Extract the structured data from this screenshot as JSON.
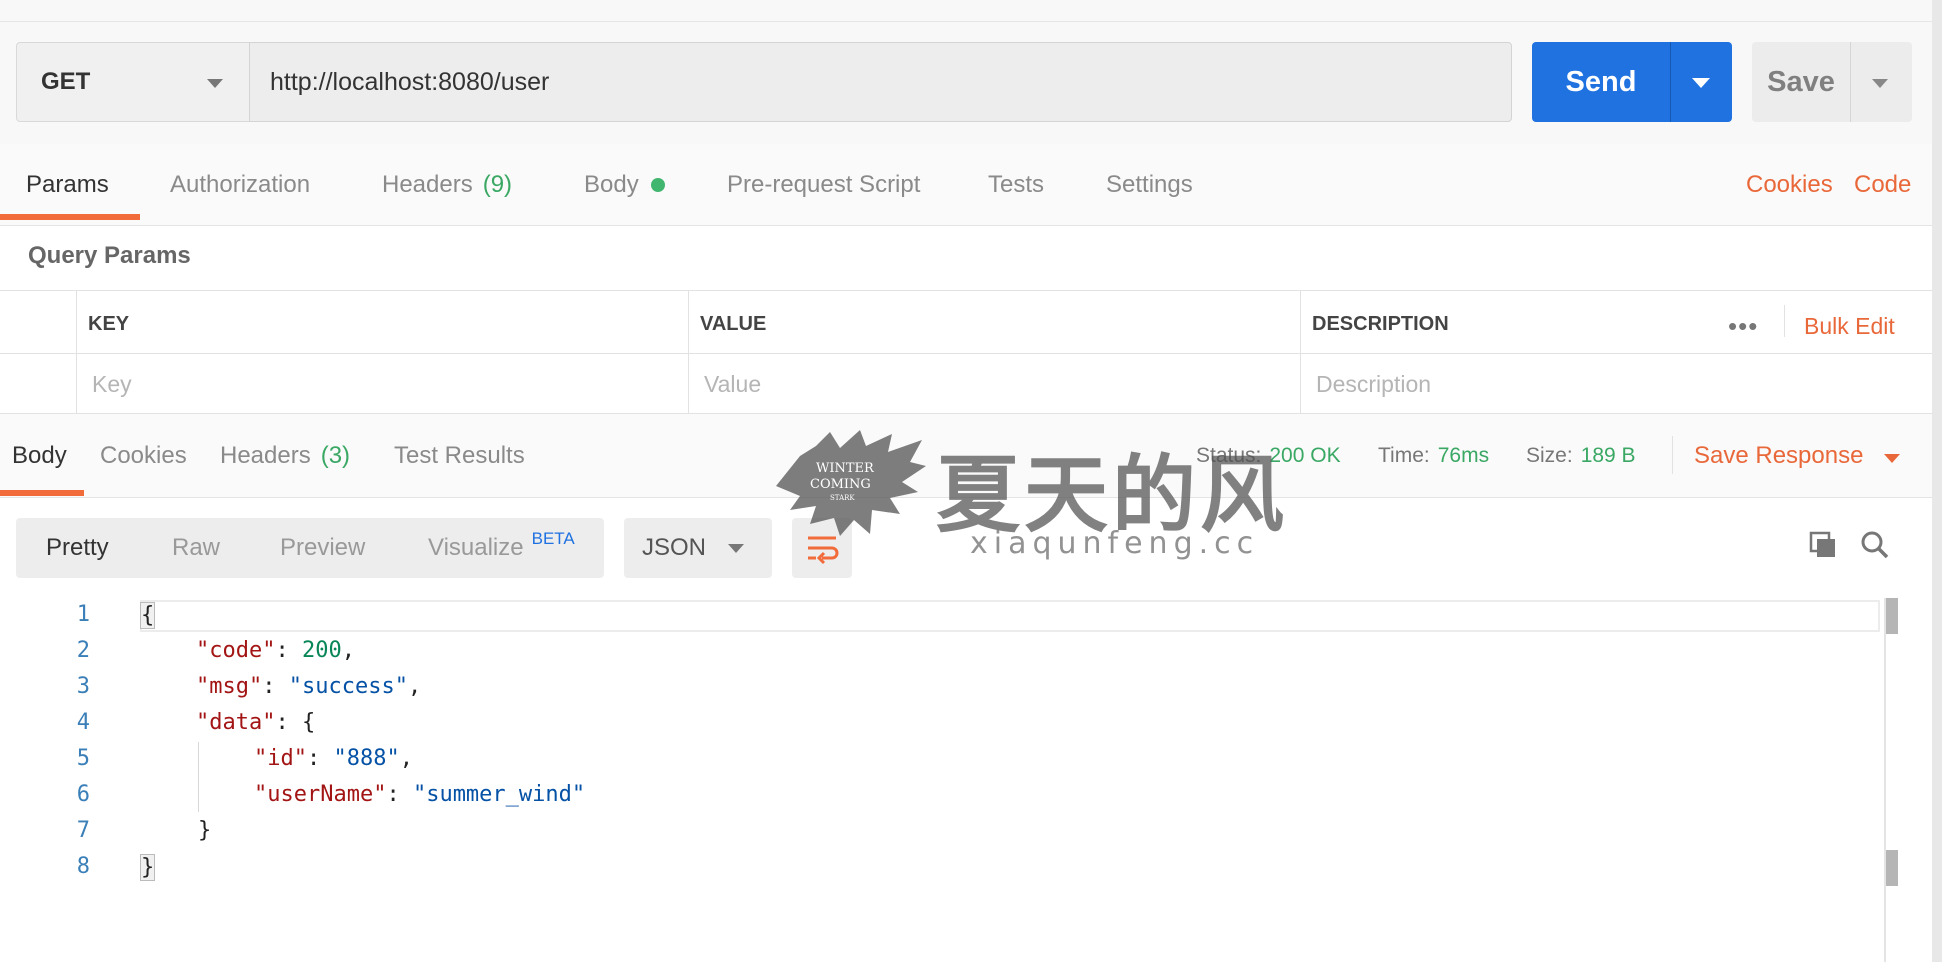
{
  "request": {
    "method": "GET",
    "url": "http://localhost:8080/user",
    "send_label": "Send",
    "save_label": "Save"
  },
  "request_tabs": [
    {
      "label": "Params"
    },
    {
      "label": "Authorization"
    },
    {
      "label": "Headers",
      "count": "(9)"
    },
    {
      "label": "Body"
    },
    {
      "label": "Pre-request Script"
    },
    {
      "label": "Tests"
    },
    {
      "label": "Settings"
    }
  ],
  "request_links": {
    "cookies": "Cookies",
    "code": "Code"
  },
  "query_params": {
    "title": "Query Params",
    "columns": [
      "KEY",
      "VALUE",
      "DESCRIPTION"
    ],
    "placeholders": [
      "Key",
      "Value",
      "Description"
    ],
    "more": "•••",
    "bulk_edit": "Bulk Edit"
  },
  "response_tabs": [
    {
      "label": "Body"
    },
    {
      "label": "Cookies"
    },
    {
      "label": "Headers",
      "count": "(3)"
    },
    {
      "label": "Test Results"
    }
  ],
  "response_stats": {
    "status_label": "Status:",
    "status_value": "200 OK",
    "time_label": "Time:",
    "time_value": "76ms",
    "size_label": "Size:",
    "size_value": "189 B",
    "save_response": "Save Response"
  },
  "format": {
    "options": [
      "Pretty",
      "Raw",
      "Preview",
      "Visualize"
    ],
    "beta": "BETA",
    "language": "JSON"
  },
  "code": {
    "line_numbers": [
      "1",
      "2",
      "3",
      "4",
      "5",
      "6",
      "7",
      "8"
    ],
    "open_brace": "{",
    "close_brace": "}",
    "code_key": "\"code\"",
    "code_value": "200",
    "msg_key": "\"msg\"",
    "msg_value": "\"success\"",
    "data_key": "\"data\"",
    "id_key": "\"id\"",
    "id_value": "\"888\"",
    "username_key": "\"userName\"",
    "username_value": "\"summer_wind\""
  },
  "watermark": {
    "logo_line1": "WINTER",
    "logo_line2": "COMING",
    "logo_line3": "STARK",
    "chinese": "夏天的风",
    "url": "xiaqunfeng.cc"
  },
  "colors": {
    "accent_orange": "#f26b3a",
    "send_blue": "#1f72e0",
    "status_green": "#3aa864"
  }
}
